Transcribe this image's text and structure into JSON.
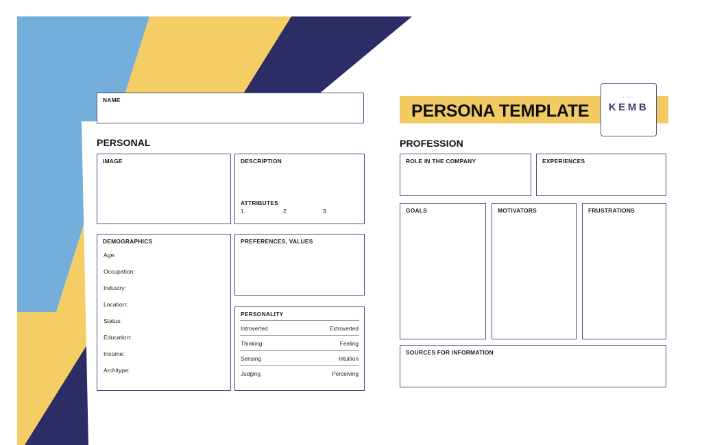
{
  "colors": {
    "stripe_blue": "#74afdb",
    "stripe_yellow": "#f5cd65",
    "stripe_navy": "#2d2d66",
    "banner_yellow": "#f2cb63",
    "box_border": "#4a4a85",
    "logo_text": "#3b3b73",
    "divider_gray": "#9a9a9a"
  },
  "header": {
    "title": "PERSONA TEMPLATE",
    "logo": {
      "word": "KEMB",
      "micro": "▪ ▪▪▪▪▪"
    }
  },
  "left": {
    "name_box": {
      "label": "NAME"
    },
    "section_heading": "PERSONAL",
    "image_box": {
      "label": "IMAGE"
    },
    "description_box": {
      "label": "DESCRIPTION",
      "attributes_label": "ATTRIBUTES",
      "attributes": [
        "1.",
        "2.",
        "3."
      ]
    },
    "demographics_box": {
      "label": "DEMOGRAPHICS",
      "fields": [
        "Age:",
        "Occupation:",
        "Industry:",
        "Location:",
        "Status:",
        "Education:",
        "Income:",
        "Architype:"
      ]
    },
    "preferences_box": {
      "label": "PREFERENCES, VALUES"
    },
    "personality_box": {
      "label": "PERSONALITY",
      "rows": [
        {
          "left": "Introverted",
          "right": "Extroverted"
        },
        {
          "left": "Thinking",
          "right": "Feeling"
        },
        {
          "left": "Sensing",
          "right": "Intuition"
        },
        {
          "left": "Judging",
          "right": "Perceiving"
        }
      ]
    }
  },
  "right": {
    "section_heading": "PROFESSION",
    "role_box": {
      "label": "ROLE IN THE COMPANY"
    },
    "experiences_box": {
      "label": "EXPERIENCES"
    },
    "goals_box": {
      "label": "GOALS"
    },
    "motivators_box": {
      "label": "MOTIVATORS"
    },
    "frustrations_box": {
      "label": "FRUSTRATIONS"
    },
    "sources_box": {
      "label": "SOURCES FOR INFORMATION"
    }
  }
}
